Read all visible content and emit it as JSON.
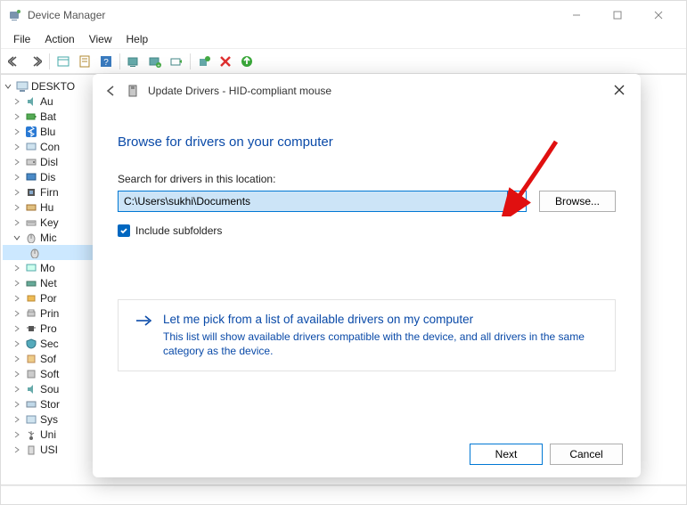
{
  "window": {
    "title": "Device Manager"
  },
  "menu": {
    "file": "File",
    "action": "Action",
    "view": "View",
    "help": "Help"
  },
  "tree": {
    "root": "DESKTO",
    "nodes": [
      {
        "label": "Au",
        "icon": "audio"
      },
      {
        "label": "Bat",
        "icon": "battery"
      },
      {
        "label": "Blu",
        "icon": "bluetooth"
      },
      {
        "label": "Con",
        "icon": "computer"
      },
      {
        "label": "Disl",
        "icon": "disk"
      },
      {
        "label": "Dis",
        "icon": "display"
      },
      {
        "label": "Firn",
        "icon": "firmware"
      },
      {
        "label": "Hu",
        "icon": "hid"
      },
      {
        "label": "Key",
        "icon": "keyboard"
      },
      {
        "label": "Mic",
        "icon": "mouse",
        "expanded": true,
        "children": [
          {
            "label": "",
            "icon": "mouse-dev",
            "selected": true
          }
        ]
      },
      {
        "label": "Mo",
        "icon": "monitor"
      },
      {
        "label": "Net",
        "icon": "network"
      },
      {
        "label": "Por",
        "icon": "ports"
      },
      {
        "label": "Prin",
        "icon": "printqueue"
      },
      {
        "label": "Pro",
        "icon": "processor"
      },
      {
        "label": "Sec",
        "icon": "security"
      },
      {
        "label": "Sof",
        "icon": "software"
      },
      {
        "label": "Soft",
        "icon": "software"
      },
      {
        "label": "Sou",
        "icon": "sound"
      },
      {
        "label": "Stor",
        "icon": "storage"
      },
      {
        "label": "Sys",
        "icon": "system"
      },
      {
        "label": "Uni",
        "icon": "usb"
      },
      {
        "label": "USI",
        "icon": "usb2"
      }
    ]
  },
  "dialog": {
    "title": "Update Drivers - HID-compliant mouse",
    "heading": "Browse for drivers on your computer",
    "search_label": "Search for drivers in this location:",
    "path_value": "C:\\Users\\sukhi\\Documents",
    "browse_label": "Browse...",
    "include_subfolders": "Include subfolders",
    "option_title": "Let me pick from a list of available drivers on my computer",
    "option_desc": "This list will show available drivers compatible with the device, and all drivers in the same category as the device.",
    "next": "Next",
    "cancel": "Cancel"
  }
}
